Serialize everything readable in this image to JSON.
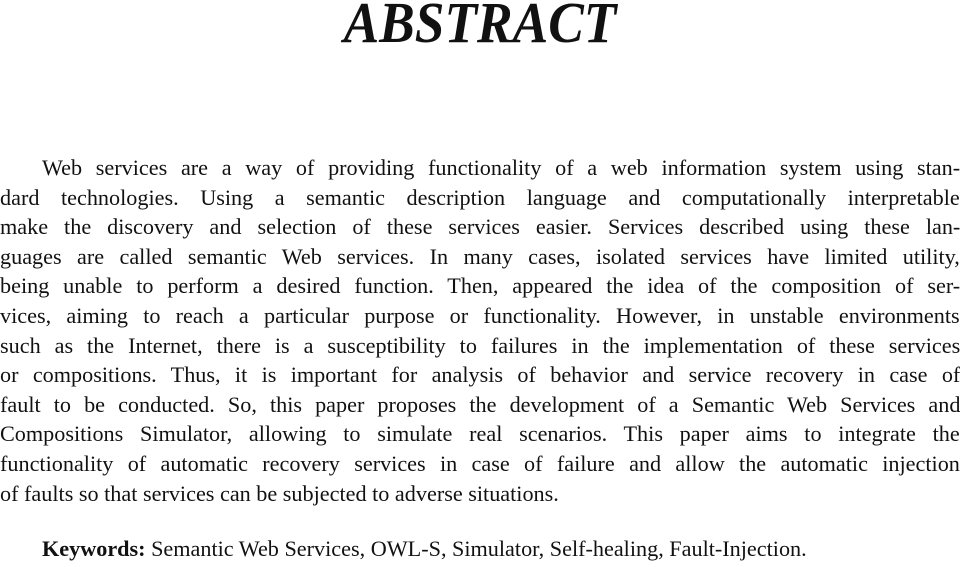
{
  "title": "ABSTRACT",
  "abstract": {
    "lines": [
      "Web services are a way of providing functionality of a web information system using stan-",
      "dard technologies.  Using a semantic description language and computationally interpretable",
      "make the discovery and selection of these services easier.  Services described using these lan-",
      "guages are called semantic Web services.  In many cases, isolated services have limited utility,",
      "being unable to perform a desired function.  Then, appeared the idea of the composition of ser-",
      "vices, aiming to reach a particular purpose or functionality.  However, in unstable environments",
      "such as the Internet, there is a susceptibility to failures in the implementation of these services",
      "or compositions.  Thus, it is important for analysis of behavior and service recovery in case of",
      "fault to be conducted.  So, this paper proposes the development of a Semantic Web Services and",
      "Compositions Simulator, allowing to simulate real scenarios.  This paper aims to integrate the",
      "functionality of automatic recovery services in case of failure and allow the automatic injection",
      "of faults so that services can be subjected to adverse situations."
    ]
  },
  "keywords": {
    "label": "Keywords:",
    "text": " Semantic Web Services, OWL-S, Simulator, Self-healing, Fault-Injection."
  }
}
